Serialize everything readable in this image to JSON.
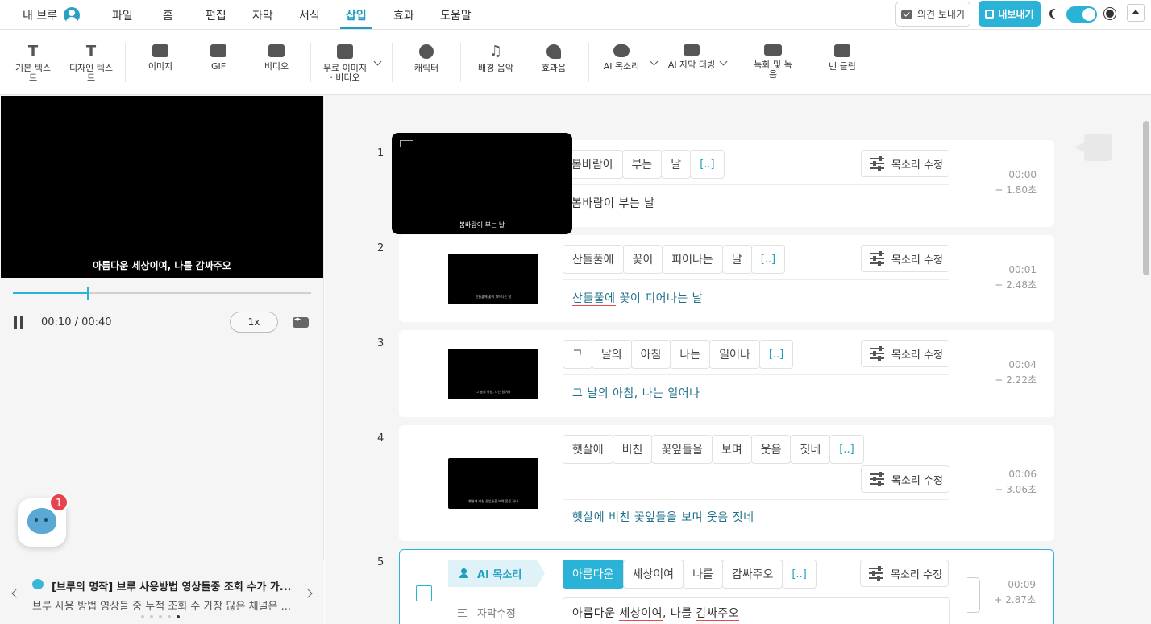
{
  "menubar": {
    "brand": "내 브루",
    "items": [
      "파일",
      "홈",
      "편집",
      "자막",
      "서식",
      "삽입",
      "효과",
      "도움말"
    ],
    "active": "삽입",
    "feedback_label": "의견 보내기",
    "export_label": "내보내기"
  },
  "toolbar": {
    "tools": [
      {
        "label": "기본 텍스트",
        "icon": "basic-text-icon"
      },
      {
        "label": "디자인 텍스트",
        "icon": "design-text-icon"
      },
      {
        "label": "이미지",
        "icon": "image-icon"
      },
      {
        "label": "GIF",
        "icon": "gif-icon"
      },
      {
        "label": "비디오",
        "icon": "video-icon"
      },
      {
        "label": "무료 이미지 · 비디오",
        "icon": "free-media-icon"
      },
      {
        "label": "캐릭터",
        "icon": "character-icon"
      },
      {
        "label": "배경 음악",
        "icon": "music-icon"
      },
      {
        "label": "효과음",
        "icon": "sound-effect-icon"
      },
      {
        "label": "AI 목소리",
        "icon": "ai-voice-icon"
      },
      {
        "label": "AI 자막 더빙",
        "icon": "ai-dubbing-icon"
      },
      {
        "label": "녹화 및 녹음",
        "icon": "record-icon"
      },
      {
        "label": "빈 클립",
        "icon": "blank-clip-icon"
      }
    ]
  },
  "preview": {
    "caption": "아름다운 세상이여, 나를 감싸주오",
    "time": "00:10 / 00:40",
    "progress": 0.25,
    "speed": "1x"
  },
  "chatbot": {
    "badge": "1"
  },
  "notice": {
    "title": "[브루의 명작] 브루 사용방법 영상들중 조회 수가 가...",
    "body": "브루 사용 방법 영상들 중 누적 조회 수 가장 많은 채널은 ...",
    "dots": 5,
    "active_dot": 4
  },
  "voice_edit_label": "목소리 수정",
  "scenes": [
    {
      "num": "1",
      "words": [
        "봄바람이",
        "부는",
        "날"
      ],
      "more": "[..]",
      "text": "봄바람이 부는 날",
      "start": "00:00",
      "duration": "+ 1.80초",
      "thumb_caption": "봄바람이 부는 날"
    },
    {
      "num": "2",
      "words": [
        "산들풀에",
        "꽃이",
        "피어나는",
        "날"
      ],
      "more": "[..]",
      "text_parts": [
        "산들풀에",
        " 꽃이 피어나는 날"
      ],
      "start": "00:01",
      "duration": "+ 2.48초",
      "thumb_caption": "산들풀에 꽃이 피어나는 날"
    },
    {
      "num": "3",
      "words": [
        "그",
        "날의",
        "아침",
        "나는",
        "일어나"
      ],
      "more": "[..]",
      "text": "그 날의 아침, 나는 일어나",
      "start": "00:04",
      "duration": "+ 2.22초",
      "thumb_caption": "그 날의 아침, 나는 일어나"
    },
    {
      "num": "4",
      "words": [
        "햇살에",
        "비친",
        "꽃잎들을",
        "보며",
        "웃음",
        "짓네"
      ],
      "more": "[..]",
      "text": "햇살에 비친 꽃잎들을 보며 웃음 짓네",
      "start": "00:06",
      "duration": "+ 3.06초",
      "thumb_caption": "햇살에 비친 꽃잎들을 보며 웃음 짓네"
    },
    {
      "num": "5",
      "words": [
        "아름다운",
        "세상이여",
        "나를",
        "감싸주오"
      ],
      "more": "[..]",
      "text_parts": [
        "아름다운 ",
        "세상이여",
        ", 나를 ",
        "감싸주오"
      ],
      "start": "00:09",
      "duration": "+ 2.87초",
      "ai_voice_label": "AI 목소리",
      "sub_edit_label": "자막수정"
    }
  ]
}
